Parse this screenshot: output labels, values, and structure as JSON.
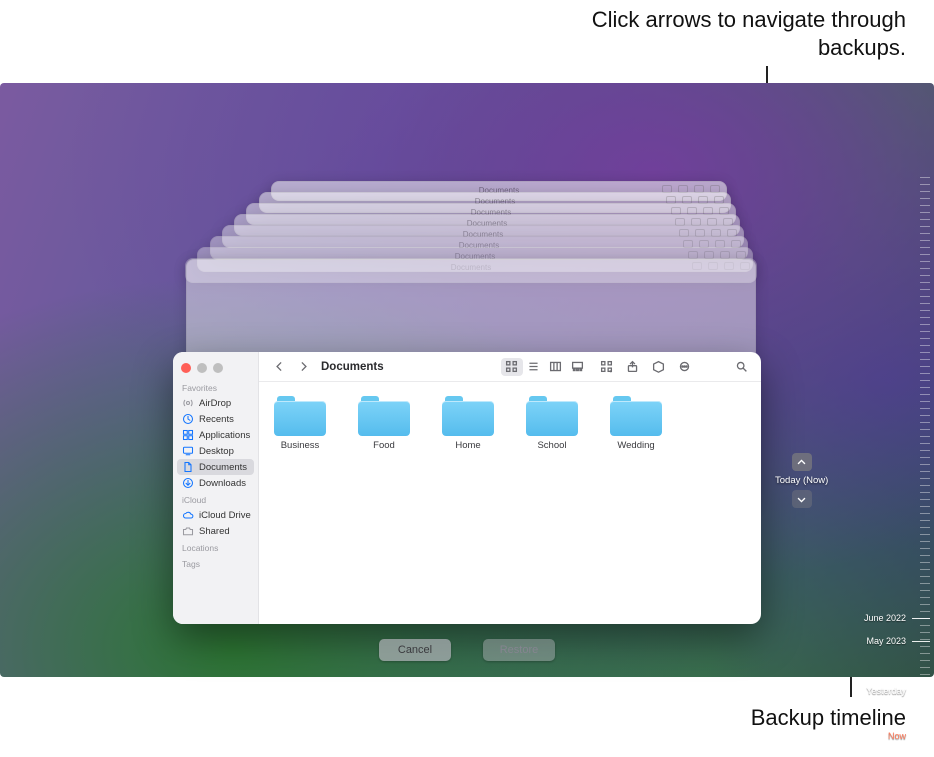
{
  "annotations": {
    "top": "Click arrows to navigate through backups.",
    "bottom": "Backup timeline"
  },
  "nav_panel": {
    "current_label": "Today (Now)"
  },
  "buttons": {
    "cancel": "Cancel",
    "restore": "Restore"
  },
  "finder": {
    "title": "Documents",
    "sidebar": {
      "sections": {
        "favorites": "Favorites",
        "icloud": "iCloud",
        "locations": "Locations",
        "tags": "Tags"
      },
      "favorites": [
        {
          "label": "AirDrop",
          "icon": "airdrop",
          "sel": false,
          "gray": true
        },
        {
          "label": "Recents",
          "icon": "clock",
          "sel": false
        },
        {
          "label": "Applications",
          "icon": "apps",
          "sel": false
        },
        {
          "label": "Desktop",
          "icon": "desktop",
          "sel": false
        },
        {
          "label": "Documents",
          "icon": "doc",
          "sel": true
        },
        {
          "label": "Downloads",
          "icon": "download",
          "sel": false
        }
      ],
      "icloud": [
        {
          "label": "iCloud Drive",
          "icon": "cloud",
          "sel": false
        },
        {
          "label": "Shared",
          "icon": "shared",
          "sel": false,
          "gray": true
        }
      ]
    },
    "folders": [
      {
        "name": "Business"
      },
      {
        "name": "Food"
      },
      {
        "name": "Home"
      },
      {
        "name": "School"
      },
      {
        "name": "Wedding"
      }
    ]
  },
  "stacked_title": "Documents",
  "timeline": {
    "labels": [
      {
        "text": "June 2022",
        "pos": 451
      },
      {
        "text": "May 2023",
        "pos": 474
      },
      {
        "text": "Yesterday",
        "pos": 524
      },
      {
        "text": "Now",
        "pos": 569,
        "now": true
      }
    ]
  }
}
